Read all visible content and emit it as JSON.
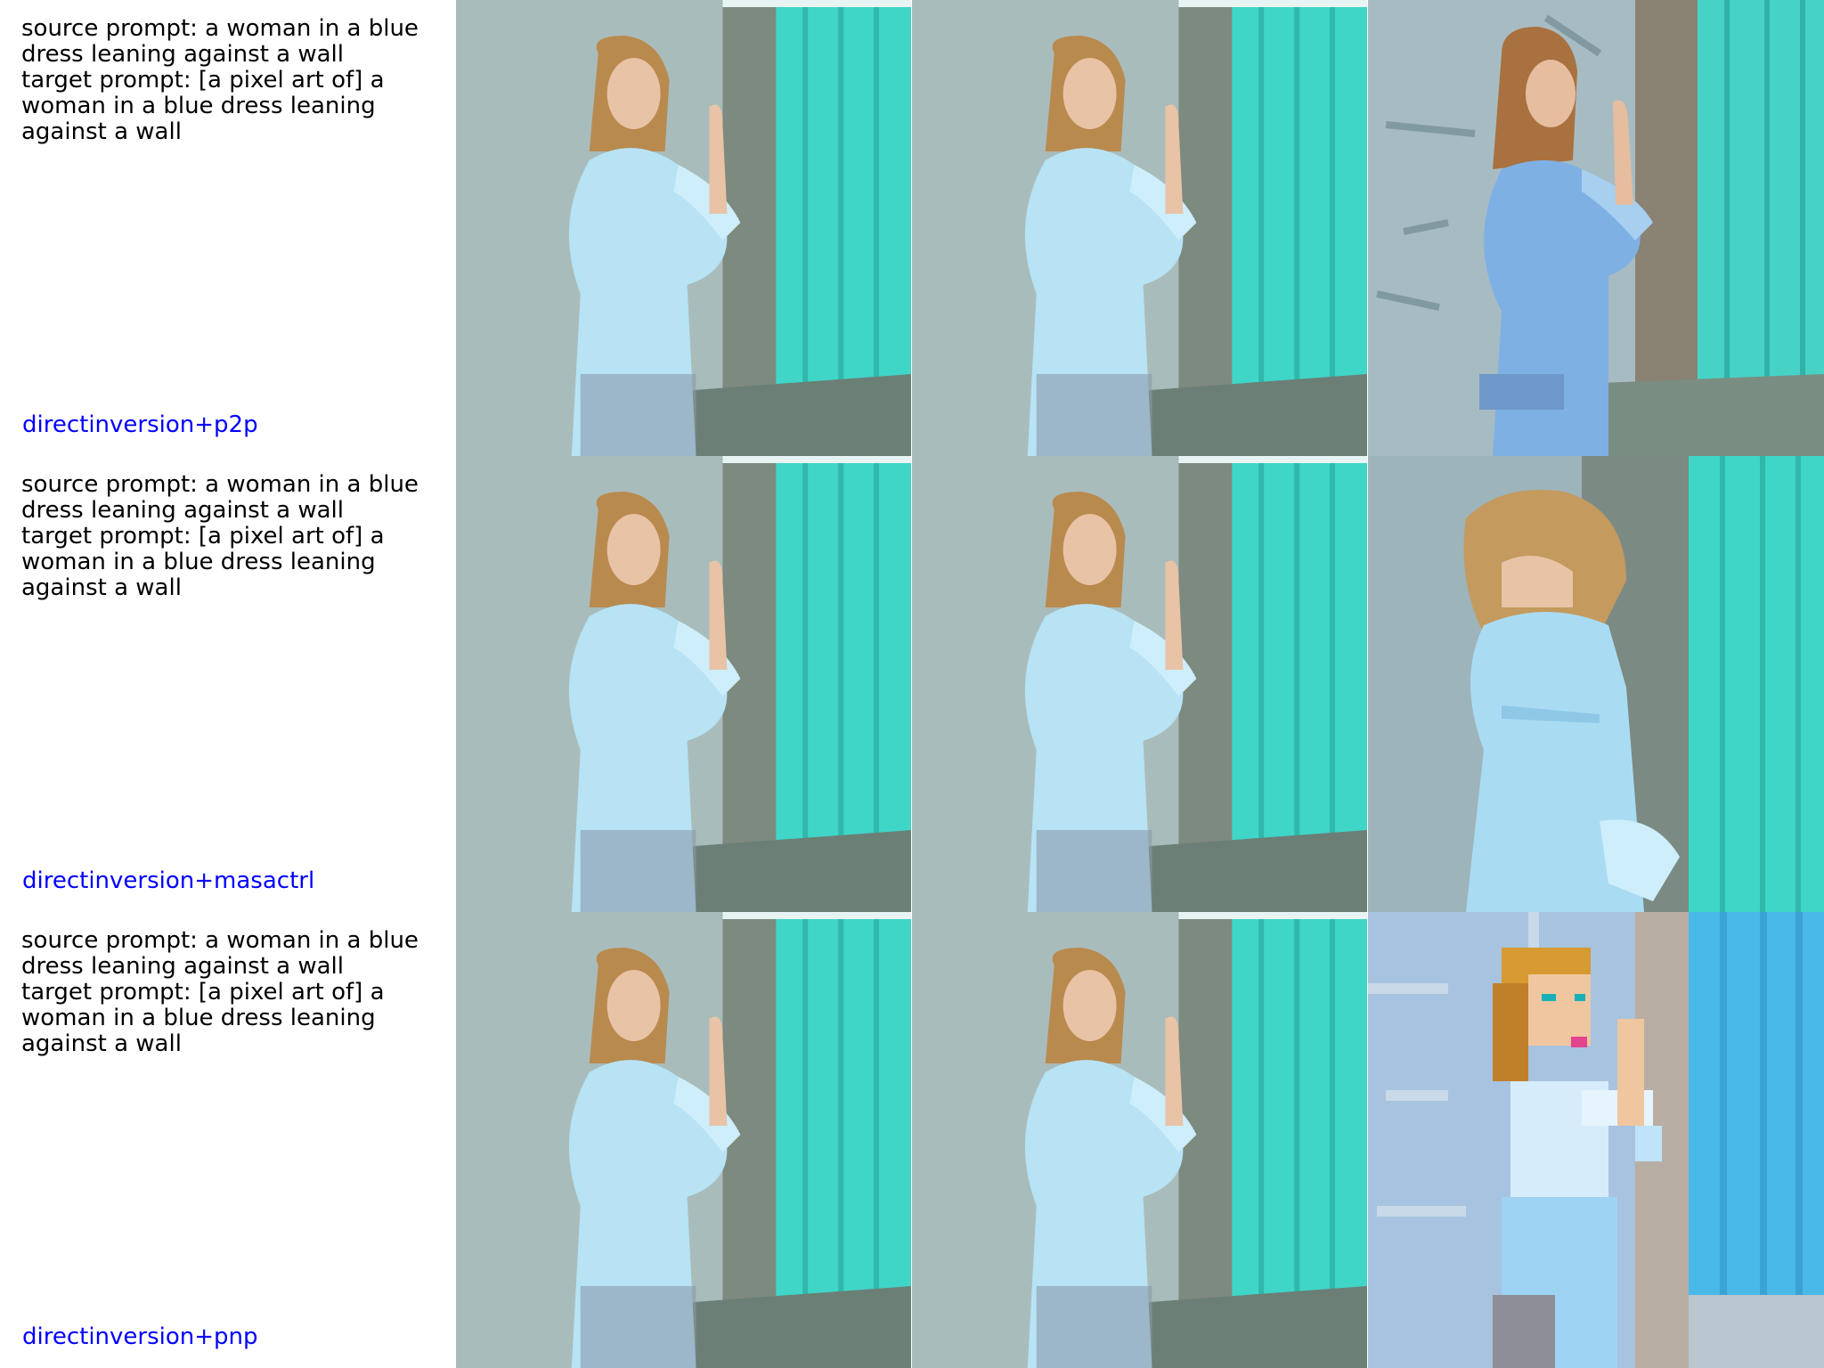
{
  "rows": [
    {
      "source_prompt": "source prompt: a woman in a blue dress leaning against a wall",
      "target_prompt": "target prompt: [a pixel art of] a woman in a blue dress leaning against a wall",
      "method": "directinversion+p2p"
    },
    {
      "source_prompt": "source prompt: a woman in a blue dress leaning against a wall",
      "target_prompt": "target prompt: [a pixel art of] a woman in a blue dress leaning against a wall",
      "method": "directinversion+masactrl"
    },
    {
      "source_prompt": "source prompt: a woman in a blue dress leaning against a wall",
      "target_prompt": "target prompt: [a pixel art of] a woman in a blue dress leaning against a wall",
      "method": "directinversion+pnp"
    }
  ],
  "colors": {
    "method_label": "#0000ff",
    "wall": "#9fb3b5",
    "door_teal": "#3fd6c8",
    "dress_blue": "#b7e3f5",
    "hair": "#b98a4e",
    "floor": "#6b7f76"
  }
}
